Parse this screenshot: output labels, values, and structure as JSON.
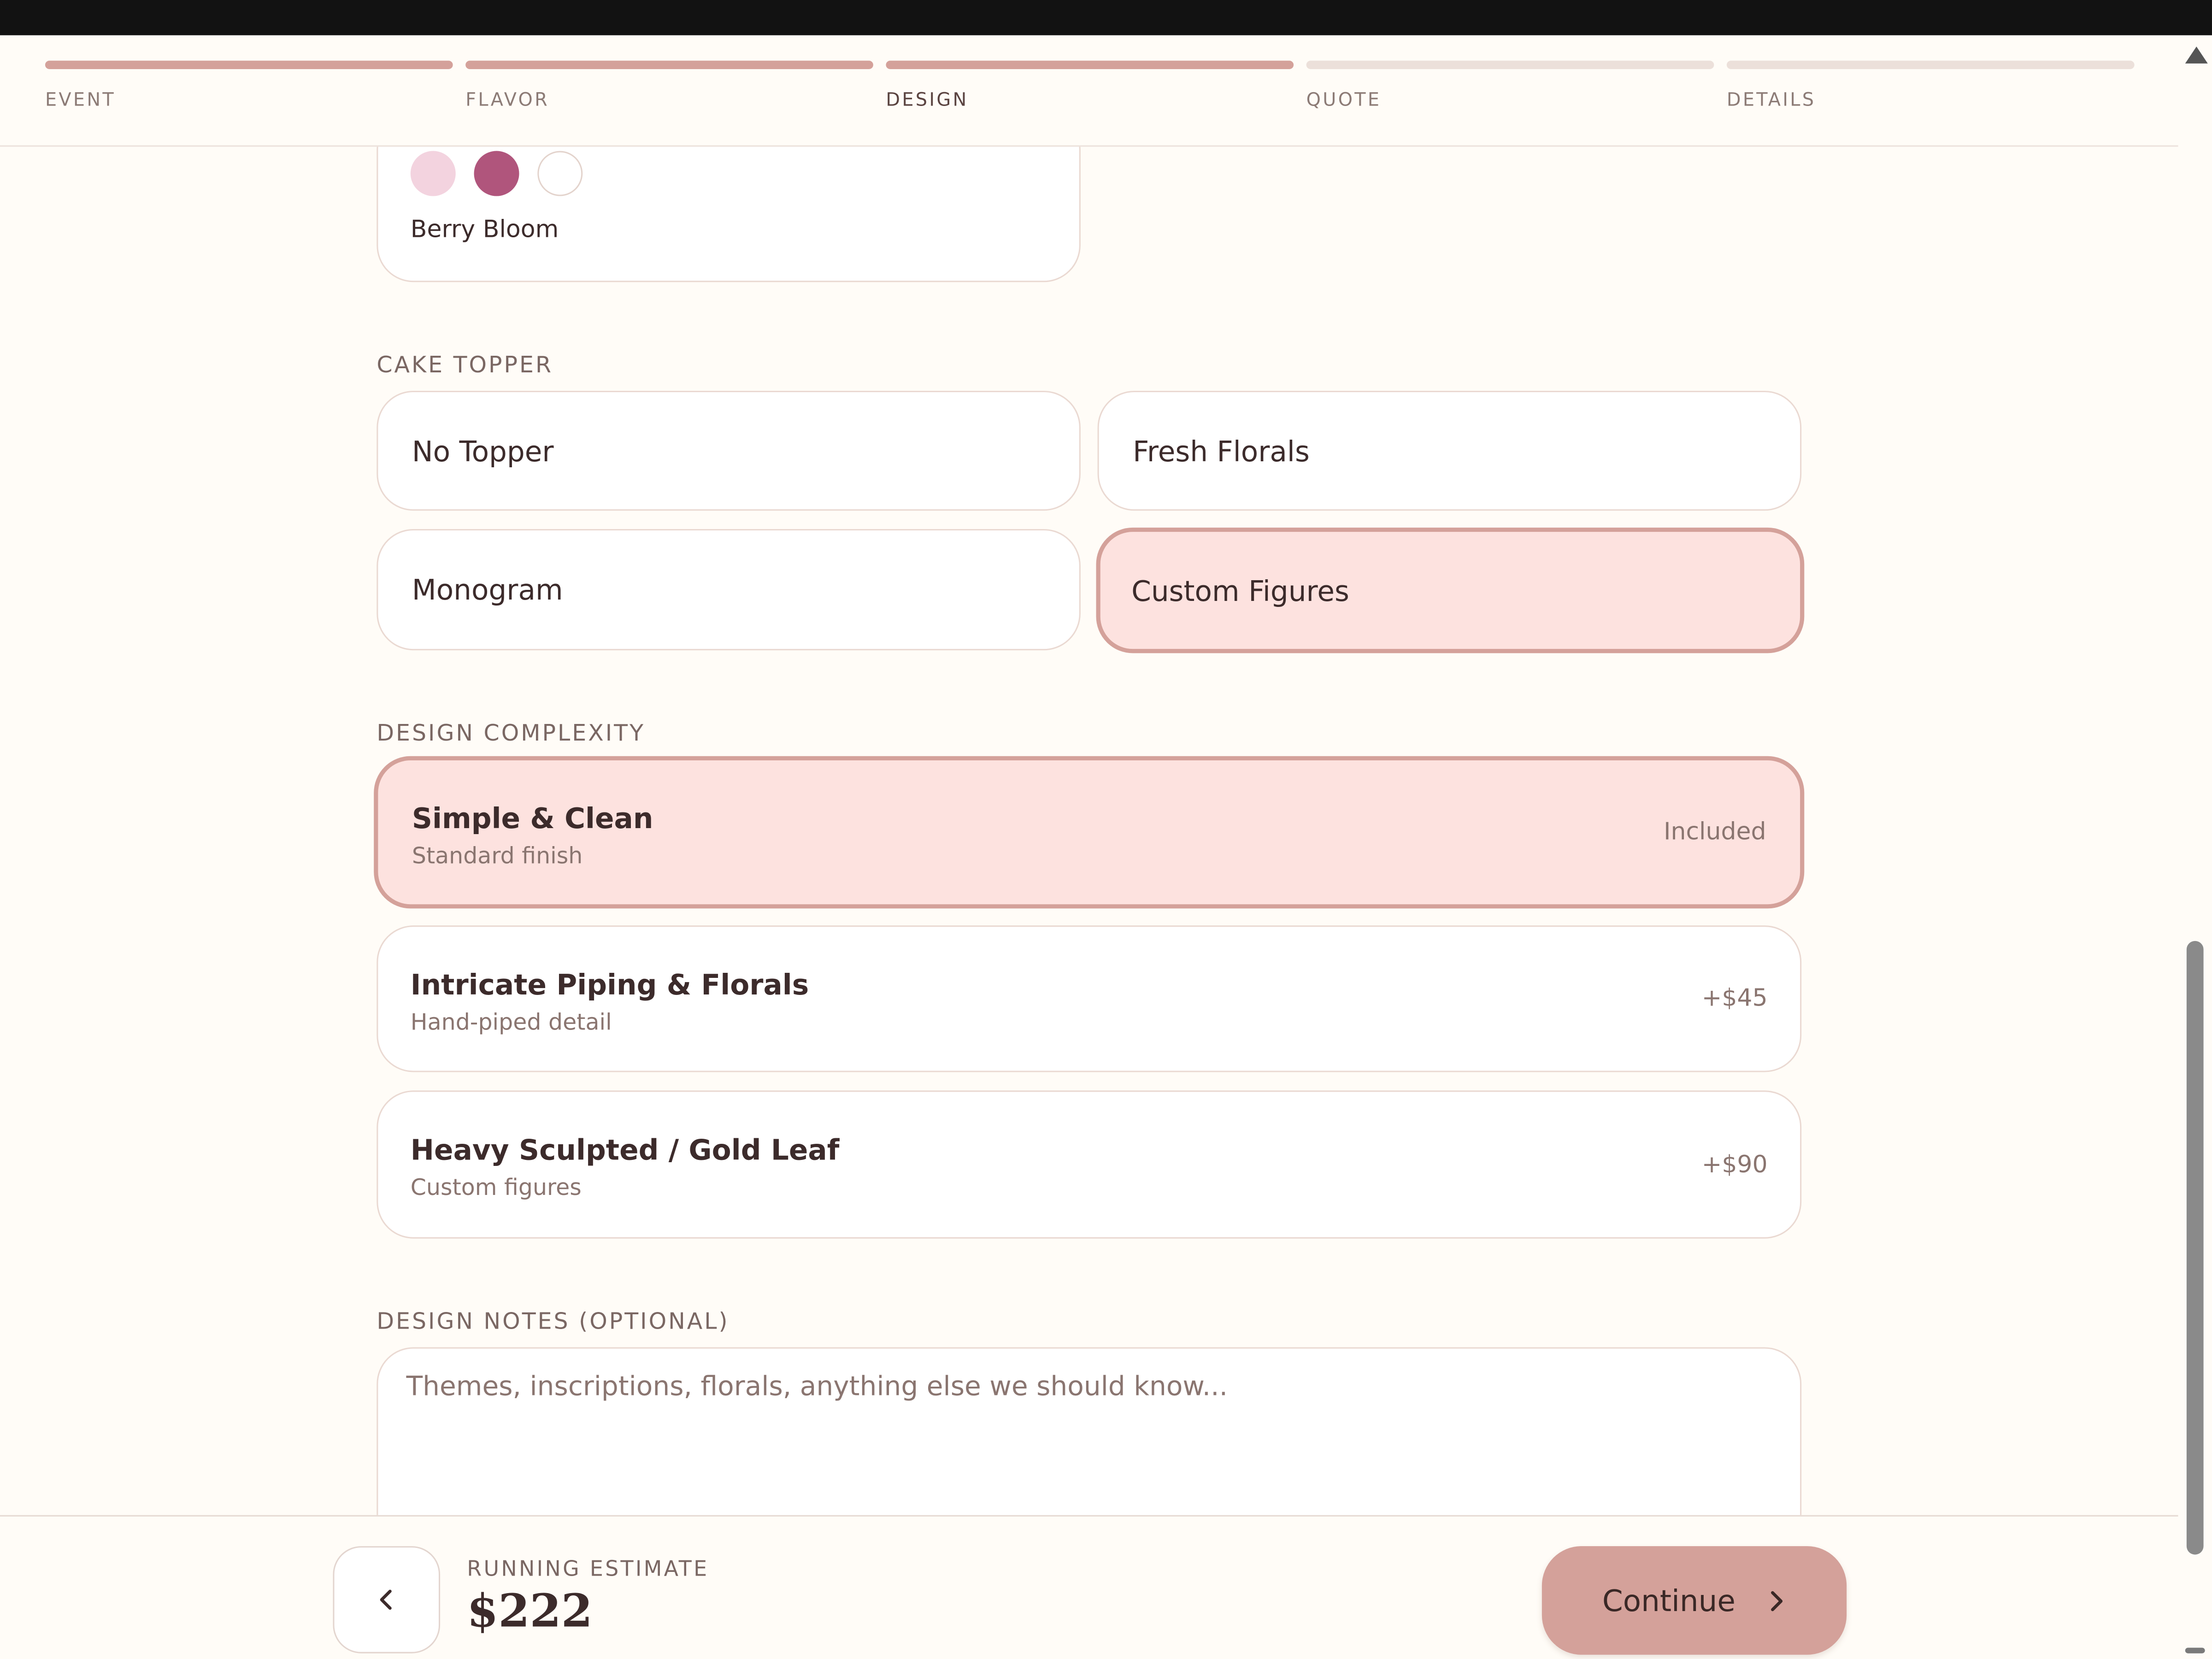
{
  "progress": {
    "steps": [
      {
        "label": "EVENT",
        "state": "done"
      },
      {
        "label": "FLAVOR",
        "state": "done"
      },
      {
        "label": "DESIGN",
        "state": "current"
      },
      {
        "label": "QUOTE",
        "state": "upcoming"
      },
      {
        "label": "DETAILS",
        "state": "upcoming"
      }
    ]
  },
  "palette": {
    "name": "Berry Bloom",
    "swatches": [
      "#f3d3df",
      "#b0557c",
      "#ffffff"
    ]
  },
  "topper": {
    "section_label": "CAKE TOPPER",
    "options": [
      {
        "label": "No Topper",
        "selected": false
      },
      {
        "label": "Fresh Florals",
        "selected": false
      },
      {
        "label": "Monogram",
        "selected": false
      },
      {
        "label": "Custom Figures",
        "selected": true
      }
    ]
  },
  "complexity": {
    "section_label": "DESIGN COMPLEXITY",
    "options": [
      {
        "title": "Simple & Clean",
        "subtitle": "Standard finish",
        "price": "Included",
        "selected": true
      },
      {
        "title": "Intricate Piping & Florals",
        "subtitle": "Hand-piped detail",
        "price": "+$45",
        "selected": false
      },
      {
        "title": "Heavy Sculpted / Gold Leaf",
        "subtitle": "Custom figures",
        "price": "+$90",
        "selected": false
      }
    ]
  },
  "notes": {
    "section_label": "DESIGN NOTES (OPTIONAL)",
    "placeholder": "Themes, inscriptions, florals, anything else we should know...",
    "value": ""
  },
  "footer": {
    "estimate_label": "RUNNING ESTIMATE",
    "estimate_value": "$222",
    "continue_label": "Continue",
    "back_icon": "chevron-left-icon",
    "continue_icon": "chevron-right-icon"
  },
  "colors": {
    "accent": "#d4a19a",
    "selected_bg": "#fde2df",
    "background": "#fffcf7"
  }
}
